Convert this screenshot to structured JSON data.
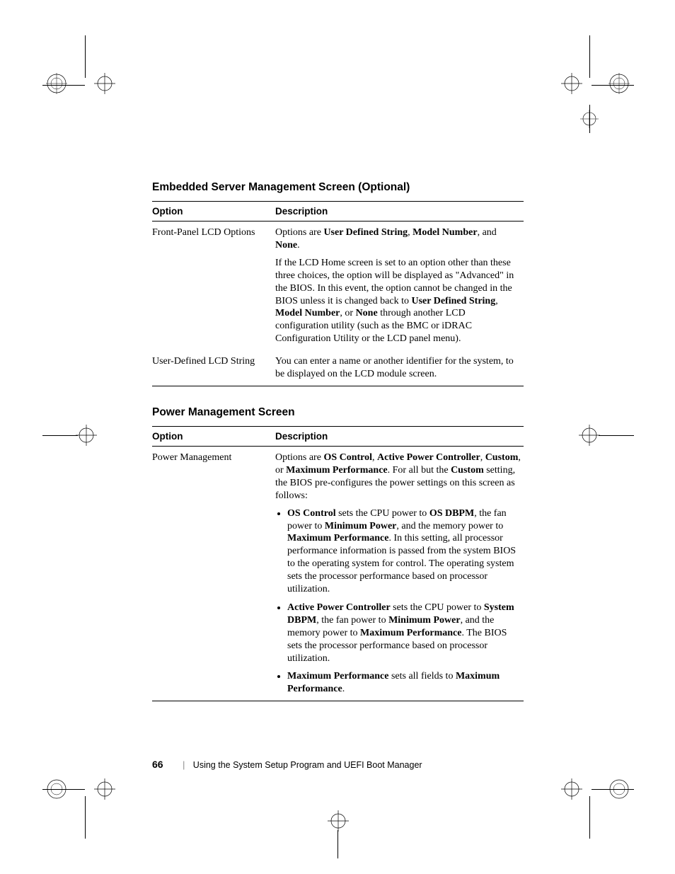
{
  "section1": {
    "heading": "Embedded Server Management Screen (Optional)",
    "col1": "Option",
    "col2": "Description",
    "rows": [
      {
        "option": "Front-Panel LCD Options",
        "desc_html": "<p>Options are <b>User Defined String</b>, <b>Model Number</b>, and <b>None</b>.</p><p>If the LCD Home screen is set to an option other than these three choices, the option will be displayed as \"Advanced\" in the BIOS. In this event, the option cannot be changed in the BIOS unless it is changed back to <b>User Defined String</b>, <b>Model Number</b>, or <b>None</b> through another LCD configuration utility (such as the BMC or iDRAC Configuration Utility or the LCD panel menu).</p>"
      },
      {
        "option": "User-Defined LCD String",
        "desc_html": "<p>You can enter a name or another identifier for the system, to be displayed on the LCD module screen.</p>"
      }
    ]
  },
  "section2": {
    "heading": "Power Management Screen",
    "col1": "Option",
    "col2": "Description",
    "rows": [
      {
        "option": "Power Management",
        "desc_html": "<p>Options are <b>OS Control</b>, <b>Active Power Controller</b>, <b>Custom</b>, or <b>Maximum Performance</b>. For all but the <b>Custom</b> setting, the BIOS pre-configures the power settings on this screen as follows:</p><ul><li><b>OS Control</b> sets the CPU power to <b>OS DBPM</b>, the fan power to <b>Minimum Power</b>, and the memory power to <b>Maximum Performance</b>. In this setting, all processor performance information is passed from the system BIOS to the operating system for control. The operating system sets the processor performance based on processor utilization.</li><li><b>Active Power Controller</b> sets the CPU power to <b>System DBPM</b>, the fan power to <b>Minimum Power</b>, and the memory power to <b>Maximum Performance</b>. The BIOS sets the processor performance based on processor utilization.</li><li><b>Maximum Performance</b> sets all fields to <b>Maximum Performance</b>.</li></ul>"
      }
    ]
  },
  "footer": {
    "page": "66",
    "title": "Using the System Setup Program and UEFI Boot Manager"
  }
}
